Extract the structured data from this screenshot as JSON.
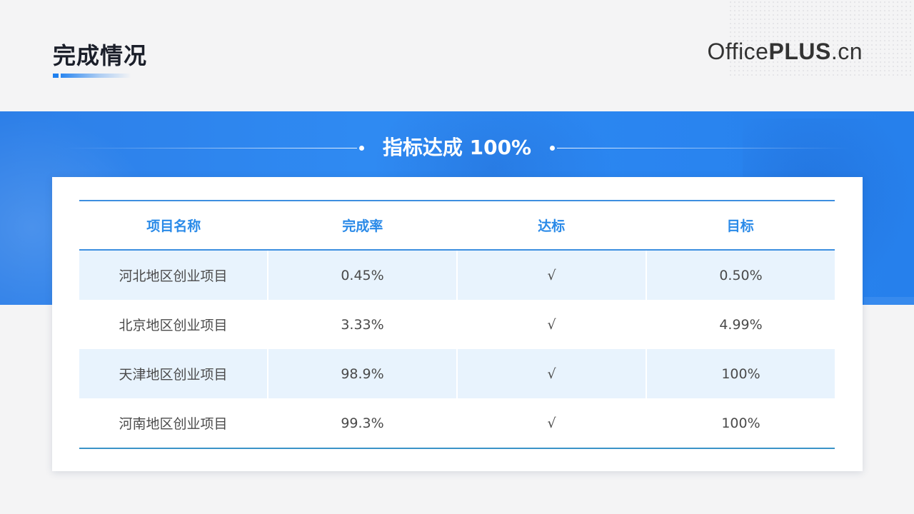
{
  "header": {
    "title": "完成情况",
    "logo_regular": "Office",
    "logo_bold": "PLUS",
    "logo_suffix": ".cn"
  },
  "banner": {
    "headline": "指标达成 100%"
  },
  "table": {
    "columns": [
      "项目名称",
      "完成率",
      "达标",
      "目标"
    ],
    "rows": [
      [
        "河北地区创业项目",
        "0.45%",
        "√",
        "0.50%"
      ],
      [
        "北京地区创业项目",
        "3.33%",
        "√",
        "4.99%"
      ],
      [
        "天津地区创业项目",
        "98.9%",
        "√",
        "100%"
      ],
      [
        "河南地区创业项目",
        "99.3%",
        "√",
        "100%"
      ]
    ]
  },
  "colors": {
    "accent": "#2a8ae8",
    "banner": "#2f8af2",
    "row_shade": "#e8f3fd",
    "title": "#1b1f2a"
  }
}
